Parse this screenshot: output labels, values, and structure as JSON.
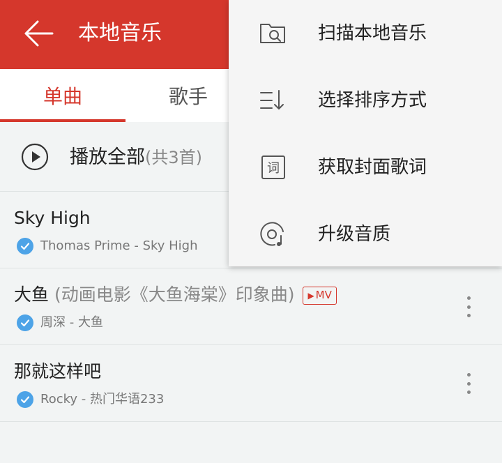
{
  "appbar": {
    "title": "本地音乐",
    "accent": "#d5372c"
  },
  "tabs": [
    {
      "label": "单曲",
      "active": true
    },
    {
      "label": "歌手"
    }
  ],
  "play_all": {
    "label": "播放全部",
    "count": "(共3首)"
  },
  "songs": [
    {
      "title": "Sky High",
      "subtitle": "",
      "mv": "",
      "artist": "Thomas Prime - Sky High"
    },
    {
      "title": "大鱼",
      "subtitle": " (动画电影《大鱼海棠》印象曲)",
      "mv": "MV",
      "artist": "周深 - 大鱼"
    },
    {
      "title": "那就这样吧",
      "subtitle": "",
      "mv": "",
      "artist": "Rocky - 热门华语233"
    }
  ],
  "menu": {
    "items": [
      {
        "label": "扫描本地音乐",
        "icon": "scan-folder-icon"
      },
      {
        "label": "选择排序方式",
        "icon": "sort-icon"
      },
      {
        "label": "获取封面歌词",
        "icon": "lyrics-icon"
      },
      {
        "label": "升级音质",
        "icon": "quality-disc-icon"
      }
    ]
  },
  "colors": {
    "check": "#4da3e7",
    "background": "#f2f4f4"
  }
}
